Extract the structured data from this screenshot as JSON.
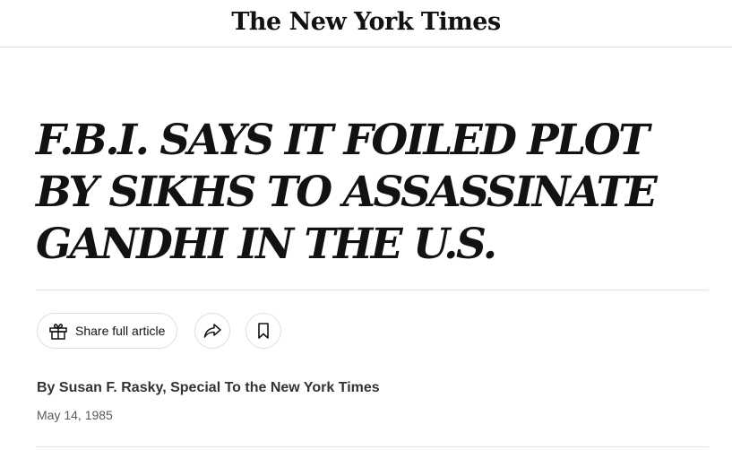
{
  "masthead": {
    "logo_text": "The New York Times"
  },
  "article": {
    "headline": "F.B.I. SAYS IT FOILED PLOT BY SIKHS TO ASSASSINATE GANDHI IN THE U.S.",
    "byline": "By Susan F. Rasky, Special To the New York Times",
    "date": "May 14, 1985"
  },
  "toolbar": {
    "share_full_article_label": "Share full article",
    "icons": {
      "gift": "gift-icon",
      "share": "share-arrow-icon",
      "save": "bookmark-icon"
    }
  }
}
